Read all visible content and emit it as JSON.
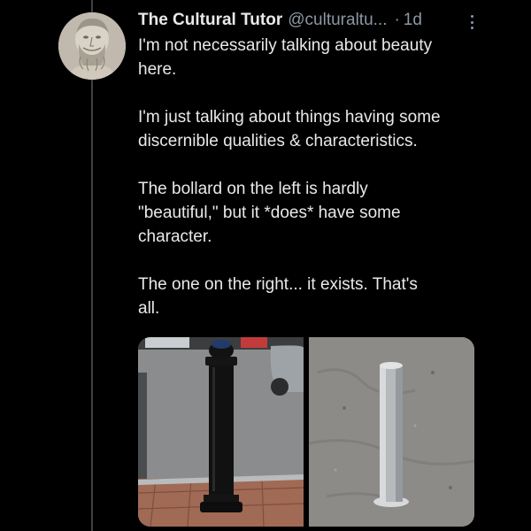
{
  "tweet": {
    "author": "The Cultural Tutor",
    "handle": "@culturaltu...",
    "separator": "·",
    "time": "1d",
    "paragraphs": [
      "I'm not necessarily talking about beauty\nhere.",
      "I'm just talking about things having some\ndiscernible qualities & characteristics.",
      "The bollard on the left is hardly\n\"beautiful,\" but it *does* have some\ncharacter.",
      "The one on the right... it exists. That's\nall."
    ]
  },
  "icons": {
    "avatar": "classical-bust-avatar",
    "more": "more-options-icon"
  },
  "colors": {
    "background": "#000000",
    "text": "#e7e9ea",
    "secondary_text": "#8b98a5",
    "thread_line": "#3e4144"
  }
}
